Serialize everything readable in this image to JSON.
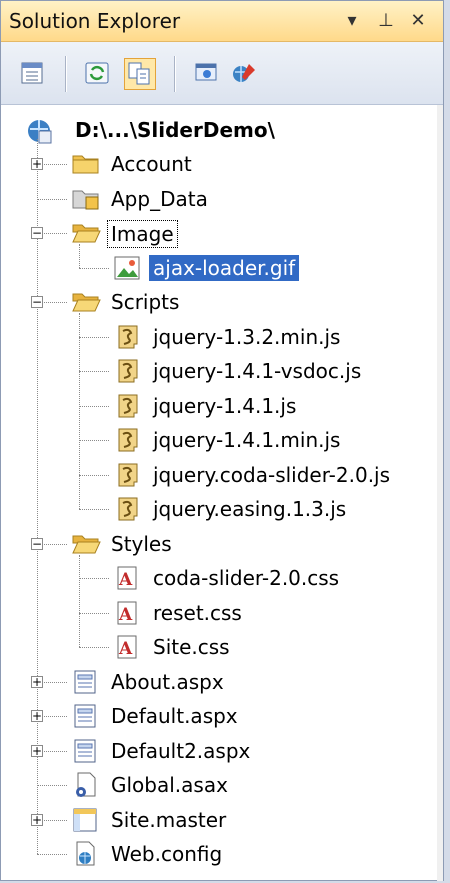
{
  "window": {
    "title": "Solution Explorer",
    "title_buttons": [
      "▾",
      "⊥",
      "✕"
    ]
  },
  "toolbar": {
    "tools": [
      {
        "name": "properties-tool-icon"
      },
      {
        "name": "refresh-tool-icon"
      },
      {
        "name": "show-all-files-tool-icon",
        "active": true
      },
      {
        "name": "view-designer-tool-icon"
      },
      {
        "name": "web-configuration-tool-icon"
      }
    ]
  },
  "project": {
    "label": "D:\\...\\SliderDemo\\"
  },
  "items": [
    {
      "label": "Account",
      "icon": "folder",
      "depth": 1,
      "expander": "+"
    },
    {
      "label": "App_Data",
      "icon": "data-folder",
      "depth": 1,
      "expander": ""
    },
    {
      "label": "Image",
      "icon": "folder-open",
      "depth": 1,
      "expander": "-",
      "focused": true
    },
    {
      "label": "ajax-loader.gif",
      "icon": "image",
      "depth": 2,
      "expander": "",
      "selected": true
    },
    {
      "label": "Scripts",
      "icon": "folder-open",
      "depth": 1,
      "expander": "-"
    },
    {
      "label": "jquery-1.3.2.min.js",
      "icon": "script",
      "depth": 2,
      "expander": ""
    },
    {
      "label": "jquery-1.4.1-vsdoc.js",
      "icon": "script",
      "depth": 2,
      "expander": ""
    },
    {
      "label": "jquery-1.4.1.js",
      "icon": "script",
      "depth": 2,
      "expander": ""
    },
    {
      "label": "jquery-1.4.1.min.js",
      "icon": "script",
      "depth": 2,
      "expander": ""
    },
    {
      "label": "jquery.coda-slider-2.0.js",
      "icon": "script",
      "depth": 2,
      "expander": ""
    },
    {
      "label": "jquery.easing.1.3.js",
      "icon": "script",
      "depth": 2,
      "expander": ""
    },
    {
      "label": "Styles",
      "icon": "folder-open",
      "depth": 1,
      "expander": "-"
    },
    {
      "label": "coda-slider-2.0.css",
      "icon": "css",
      "depth": 2,
      "expander": ""
    },
    {
      "label": "reset.css",
      "icon": "css",
      "depth": 2,
      "expander": ""
    },
    {
      "label": "Site.css",
      "icon": "css",
      "depth": 2,
      "expander": ""
    },
    {
      "label": "About.aspx",
      "icon": "aspx",
      "depth": 1,
      "expander": "+"
    },
    {
      "label": "Default.aspx",
      "icon": "aspx",
      "depth": 1,
      "expander": "+"
    },
    {
      "label": "Default2.aspx",
      "icon": "aspx",
      "depth": 1,
      "expander": "+"
    },
    {
      "label": "Global.asax",
      "icon": "asax",
      "depth": 1,
      "expander": ""
    },
    {
      "label": "Site.master",
      "icon": "master",
      "depth": 1,
      "expander": "+"
    },
    {
      "label": "Web.config",
      "icon": "config",
      "depth": 1,
      "expander": ""
    }
  ],
  "colors": {
    "selection": "#316ac5",
    "titlebar": "#ffd98a",
    "folder": "#f1c24f"
  }
}
